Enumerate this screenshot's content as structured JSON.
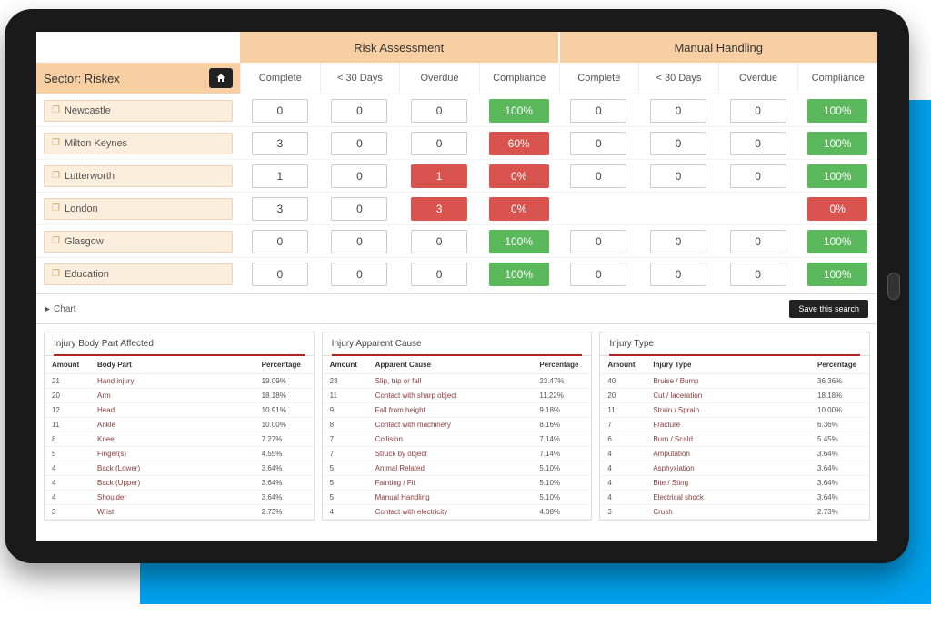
{
  "header": {
    "sections": [
      "Risk Assessment",
      "Manual Handling"
    ],
    "sector_label": "Sector: Riskex",
    "columns": [
      "Complete",
      "< 30 Days",
      "Overdue",
      "Compliance",
      "Complete",
      "< 30 Days",
      "Overdue",
      "Compliance"
    ]
  },
  "locations": [
    {
      "name": "Newcastle",
      "cells": [
        "0",
        "0",
        "0",
        "100%",
        "0",
        "0",
        "0",
        "100%"
      ],
      "flags": [
        "",
        "",
        "",
        "green",
        "",
        "",
        "",
        "green"
      ]
    },
    {
      "name": "Milton Keynes",
      "cells": [
        "3",
        "0",
        "0",
        "60%",
        "0",
        "0",
        "0",
        "100%"
      ],
      "flags": [
        "",
        "",
        "",
        "red",
        "",
        "",
        "",
        "green"
      ]
    },
    {
      "name": "Lutterworth",
      "cells": [
        "1",
        "0",
        "1",
        "0%",
        "0",
        "0",
        "0",
        "100%"
      ],
      "flags": [
        "",
        "",
        "redbox",
        "red",
        "",
        "",
        "",
        "green"
      ]
    },
    {
      "name": "London",
      "cells": [
        "3",
        "0",
        "3",
        "0%",
        "",
        "",
        "",
        "0%"
      ],
      "flags": [
        "",
        "",
        "redbox",
        "red",
        "",
        "",
        "",
        "red"
      ]
    },
    {
      "name": "Glasgow",
      "cells": [
        "0",
        "0",
        "0",
        "100%",
        "0",
        "0",
        "0",
        "100%"
      ],
      "flags": [
        "",
        "",
        "",
        "green",
        "",
        "",
        "",
        "green"
      ]
    },
    {
      "name": "Education",
      "cells": [
        "0",
        "0",
        "0",
        "100%",
        "0",
        "0",
        "0",
        "100%"
      ],
      "flags": [
        "",
        "",
        "",
        "green",
        "",
        "",
        "",
        "green"
      ]
    }
  ],
  "bottom": {
    "chart_label": "Chart",
    "save_label": "Save this search"
  },
  "panels": [
    {
      "title": "Injury Body Part Affected",
      "headers": [
        "Amount",
        "Body Part",
        "Percentage"
      ],
      "rows": [
        [
          "21",
          "Hand injury",
          "19.09%"
        ],
        [
          "20",
          "Arm",
          "18.18%"
        ],
        [
          "12",
          "Head",
          "10.91%"
        ],
        [
          "11",
          "Ankle",
          "10.00%"
        ],
        [
          "8",
          "Knee",
          "7.27%"
        ],
        [
          "5",
          "Finger(s)",
          "4.55%"
        ],
        [
          "4",
          "Back (Lower)",
          "3.64%"
        ],
        [
          "4",
          "Back (Upper)",
          "3.64%"
        ],
        [
          "4",
          "Shoulder",
          "3.64%"
        ],
        [
          "3",
          "Wrist",
          "2.73%"
        ]
      ]
    },
    {
      "title": "Injury Apparent Cause",
      "headers": [
        "Amount",
        "Apparent Cause",
        "Percentage"
      ],
      "rows": [
        [
          "23",
          "Slip, trip or fall",
          "23.47%"
        ],
        [
          "11",
          "Contact with sharp object",
          "11.22%"
        ],
        [
          "9",
          "Fall from height",
          "9.18%"
        ],
        [
          "8",
          "Contact with machinery",
          "8.16%"
        ],
        [
          "7",
          "Collision",
          "7.14%"
        ],
        [
          "7",
          "Struck by object",
          "7.14%"
        ],
        [
          "5",
          "Animal Related",
          "5.10%"
        ],
        [
          "5",
          "Fainting / Fit",
          "5.10%"
        ],
        [
          "5",
          "Manual Handling",
          "5.10%"
        ],
        [
          "4",
          "Contact with electricity",
          "4.08%"
        ]
      ]
    },
    {
      "title": "Injury Type",
      "headers": [
        "Amount",
        "Injury Type",
        "Percentage"
      ],
      "rows": [
        [
          "40",
          "Bruise / Bump",
          "36.36%"
        ],
        [
          "20",
          "Cut / laceration",
          "18.18%"
        ],
        [
          "11",
          "Strain / Sprain",
          "10.00%"
        ],
        [
          "7",
          "Fracture",
          "6.36%"
        ],
        [
          "6",
          "Burn / Scald",
          "5.45%"
        ],
        [
          "4",
          "Amputation",
          "3.64%"
        ],
        [
          "4",
          "Asphyxiation",
          "3.64%"
        ],
        [
          "4",
          "Bite / Sting",
          "3.64%"
        ],
        [
          "4",
          "Electrical shock",
          "3.64%"
        ],
        [
          "3",
          "Crush",
          "2.73%"
        ]
      ]
    }
  ]
}
